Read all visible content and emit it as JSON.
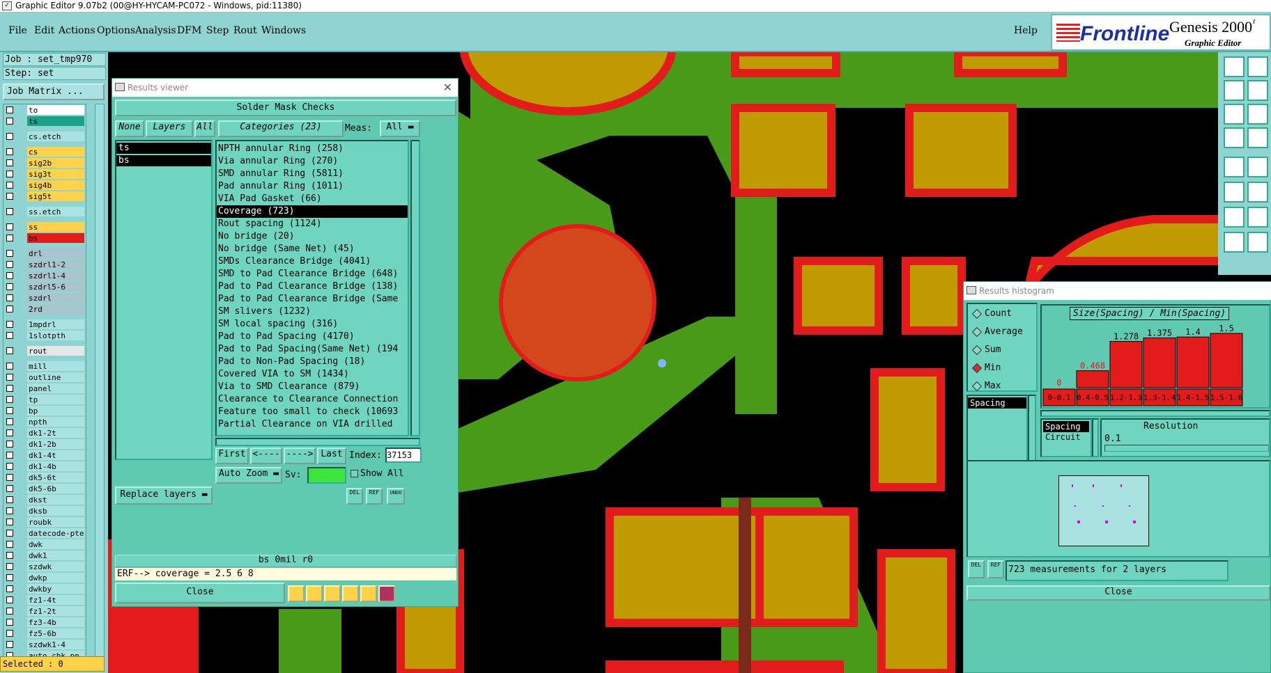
{
  "window": {
    "title": "Graphic Editor 9.07b2 (00@HY-HYCAM-PC072 - Windows, pid:11380)"
  },
  "menu": {
    "items": [
      "File",
      "Edit",
      "Actions",
      "Options",
      "Analysis",
      "DFM",
      "Step",
      "Rout",
      "Windows"
    ],
    "help": "Help"
  },
  "brand": {
    "logo": "Frontline",
    "product": "Genesis 2000",
    "product_suffix": "¹",
    "subtitle": "Graphic Editor"
  },
  "job": {
    "job": "Job : set_tmp970",
    "step": "Step: set",
    "matrix": "Job Matrix ..."
  },
  "layers": [
    {
      "name": "to",
      "color": "#ffffff"
    },
    {
      "name": "ts",
      "color": "#1aa38a"
    },
    {
      "gap": true
    },
    {
      "name": "cs.etch",
      "color": "#a9e2e1"
    },
    {
      "gap": true
    },
    {
      "name": "cs",
      "color": "#ffd24a"
    },
    {
      "name": "sig2b",
      "color": "#ffd24a"
    },
    {
      "name": "sig3t",
      "color": "#ffd24a"
    },
    {
      "name": "sig4b",
      "color": "#ffd24a"
    },
    {
      "name": "sig5t",
      "color": "#ffd24a"
    },
    {
      "gap": true
    },
    {
      "name": "ss.etch",
      "color": "#a9e2e1"
    },
    {
      "gap": true
    },
    {
      "name": "ss",
      "color": "#ffd24a"
    },
    {
      "name": "bs",
      "color": "#e21b1b"
    },
    {
      "gap": true
    },
    {
      "name": "drl",
      "color": "#a9c4cc"
    },
    {
      "name": "szdrl1-2",
      "color": "#a9c4cc"
    },
    {
      "name": "szdrl1-4",
      "color": "#a9c4cc"
    },
    {
      "name": "szdrl5-6",
      "color": "#a9c4cc"
    },
    {
      "name": "szdrl",
      "color": "#a9c4cc"
    },
    {
      "name": "2rd",
      "color": "#a9c4cc"
    },
    {
      "gap": true
    },
    {
      "name": "1mpdrl",
      "color": "#a9e2e1"
    },
    {
      "name": "1slotpth",
      "color": "#a9e2e1"
    },
    {
      "gap": true
    },
    {
      "name": "rout",
      "color": "#e6e6e6"
    },
    {
      "gap": true
    },
    {
      "name": "mill",
      "color": "#a9e2e1"
    },
    {
      "name": "outline",
      "color": "#a9e2e1"
    },
    {
      "name": "panel",
      "color": "#a9e2e1"
    },
    {
      "name": "tp",
      "color": "#a9e2e1"
    },
    {
      "name": "bp",
      "color": "#a9e2e1"
    },
    {
      "name": "npth",
      "color": "#a9e2e1"
    },
    {
      "name": "dk1-2t",
      "color": "#a9e2e1"
    },
    {
      "name": "dk1-2b",
      "color": "#a9e2e1"
    },
    {
      "name": "dk1-4t",
      "color": "#a9e2e1"
    },
    {
      "name": "dk1-4b",
      "color": "#a9e2e1"
    },
    {
      "name": "dk5-6t",
      "color": "#a9e2e1"
    },
    {
      "name": "dk5-6b",
      "color": "#a9e2e1"
    },
    {
      "name": "dkst",
      "color": "#a9e2e1"
    },
    {
      "name": "dksb",
      "color": "#a9e2e1"
    },
    {
      "name": "roubk",
      "color": "#a9e2e1"
    },
    {
      "name": "datecode-pte",
      "color": "#a9e2e1"
    },
    {
      "name": "dwk",
      "color": "#a9e2e1"
    },
    {
      "name": "dwk1",
      "color": "#a9e2e1"
    },
    {
      "name": "szdwk",
      "color": "#a9e2e1"
    },
    {
      "name": "dwkp",
      "color": "#a9e2e1"
    },
    {
      "name": "dwkby",
      "color": "#a9e2e1"
    },
    {
      "name": "fz1-4t",
      "color": "#a9e2e1"
    },
    {
      "name": "fz1-2t",
      "color": "#a9e2e1"
    },
    {
      "name": "fz3-4b",
      "color": "#a9e2e1"
    },
    {
      "name": "fz5-6b",
      "color": "#a9e2e1"
    },
    {
      "name": "szdwk1-4",
      "color": "#a9e2e1"
    },
    {
      "name": "auto_chk_pp",
      "color": "#a9e2e1"
    }
  ],
  "selected": "Selected : 0",
  "results_viewer": {
    "title": "Results viewer",
    "header": "Solder Mask Checks",
    "none": "None",
    "layers": "Layers",
    "all": "All",
    "categories_label": "Categories (23)",
    "meas_label": "Meas:",
    "meas_value": "All",
    "layer_items": [
      "ts",
      "bs"
    ],
    "categories": [
      "NPTH annular Ring (258)",
      "Via annular Ring (270)",
      "SMD annular Ring (5811)",
      "Pad annular Ring (1011)",
      "VIA Pad Gasket (66)",
      "Coverage (723)",
      "Rout spacing (1124)",
      "No bridge (20)",
      "No bridge (Same Net) (45)",
      "SMDs Clearance Bridge (4041)",
      "SMD to Pad Clearance Bridge (648)",
      "Pad to Pad Clearance Bridge (138)",
      "Pad to Pad Clearance Bridge (Same",
      "SM slivers (1232)",
      "SM local spacing (316)",
      "Pad to Pad Spacing (4170)",
      "Pad to Pad Spacing(Same Net) (194",
      "Pad to Non-Pad Spacing (18)",
      "Covered VIA to SM (1434)",
      "Via to SMD Clearance (879)",
      "Clearance to Clearance Connection",
      "Feature too small to check (10693",
      "Partial Clearance on VIA drilled"
    ],
    "selected_category": "Coverage (723)",
    "nav": {
      "first": "First",
      "prev": "<----",
      "next": "---->",
      "last": "Last",
      "index_label": "Index:",
      "index_value": "37153"
    },
    "auto_zoom": "Auto Zoom",
    "sv": "Sv:",
    "show_all": "Show All",
    "replace_layers": "Replace layers",
    "del": "DEL",
    "ref": "REF",
    "undo": "UNDO",
    "status": "bs 0mil  r0",
    "erf": "ERF--> coverage = 2.5 6 8",
    "close": "Close"
  },
  "results_histogram": {
    "title": "Results histogram",
    "modes": [
      "Count",
      "Average",
      "Sum",
      "Min",
      "Max"
    ],
    "selected_mode": "Min",
    "list": [
      "Spacing"
    ],
    "chart_title": "Size(Spacing) / Min(Spacing)",
    "resolution_label": "Resolution",
    "resolution_value": "0.1",
    "types": [
      "Spacing",
      "Circuit"
    ],
    "del": "DEL",
    "ref": "REF",
    "summary": "723 measurements for 2 layers",
    "close": "Close"
  },
  "chart_data": {
    "type": "bar",
    "title": "Size(Spacing) / Min(Spacing)",
    "categories": [
      "0-0.1",
      "0.4-0.5",
      "1.2-1.3",
      "1.3-1.4",
      "1.4-1.5",
      "1.5-1.6"
    ],
    "values": [
      0,
      0.468,
      1.278,
      1.375,
      1.4,
      1.5
    ],
    "value_labels": [
      "0",
      "0.468",
      "1.278",
      "1.375",
      "1.4",
      "1.5"
    ],
    "bar_color": "#e21b1b"
  },
  "colors": {
    "accent": "#8fd3d2",
    "panel": "#5fc9b2",
    "mask": "#e21b1b",
    "pad": "#bf9a00",
    "copper": "#4a9a1a"
  }
}
